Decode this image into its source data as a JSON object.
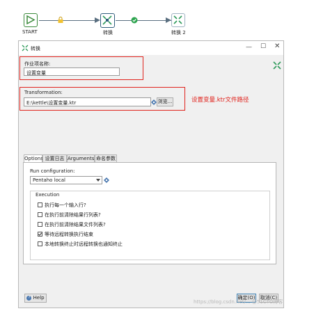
{
  "workflow": {
    "start_label": "START",
    "transform_label": "转换",
    "transform2_label": "转换 2"
  },
  "dialog": {
    "title": "转换",
    "job_name_label": "作业项名称:",
    "job_name_value": "设置变量",
    "transformation_label": "Transformation:",
    "transformation_value": "E:\\kettle\\设置变量.ktr",
    "browse_label": "浏览...",
    "annotation": "设置变量.ktr文件路径",
    "tabs": [
      "Options",
      "设置日志",
      "Arguments",
      "命名参数"
    ],
    "run_config_label": "Run configuration:",
    "run_config_value": "Pentaho local",
    "execution_label": "Execution",
    "options": [
      {
        "label": "执行每一个输入行?",
        "checked": false
      },
      {
        "label": "在执行前清除结果行列表?",
        "checked": false
      },
      {
        "label": "在执行前清除结果文件列表?",
        "checked": false
      },
      {
        "label": "等待远程转换执行结束",
        "checked": true
      },
      {
        "label": "本地转换终止时远程转换也通知终止",
        "checked": false
      }
    ],
    "help_label": "Help",
    "ok_label": "确定(O)",
    "cancel_label": "取消(C)"
  },
  "watermark": "https://blog.csdn.net/... @51CTO博客",
  "colors": {
    "accent_red": "#e0221c",
    "node_border": "#2f5d7c",
    "ok_green": "#2da44e"
  }
}
